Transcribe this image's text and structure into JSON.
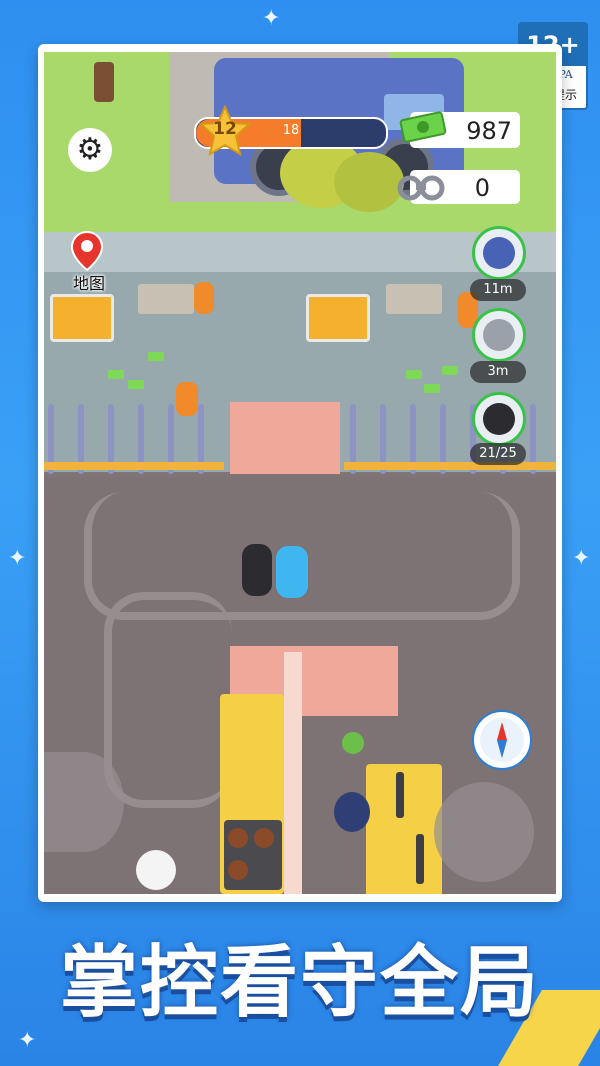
{
  "badge": {
    "age": "12+",
    "org": "CADPA",
    "tip": "适龄提示"
  },
  "hud": {
    "level": "12",
    "level_progress_text": "18",
    "level_progress_fraction": 0.55,
    "cash": "987",
    "handcuffs": "0"
  },
  "map_button": {
    "label": "地图"
  },
  "skills": [
    {
      "icon": "police-officer-icon",
      "label": "11m"
    },
    {
      "icon": "handcuffs-plus-icon",
      "label": "3m"
    },
    {
      "icon": "swat-guard-icon",
      "label": "21/25"
    }
  ],
  "slogan": "掌控看守全局",
  "colors": {
    "progress": "#f47c2a",
    "badge": "#1f6fb8",
    "cash_green": "#7ed957",
    "skill_ring": "#39c24a"
  }
}
